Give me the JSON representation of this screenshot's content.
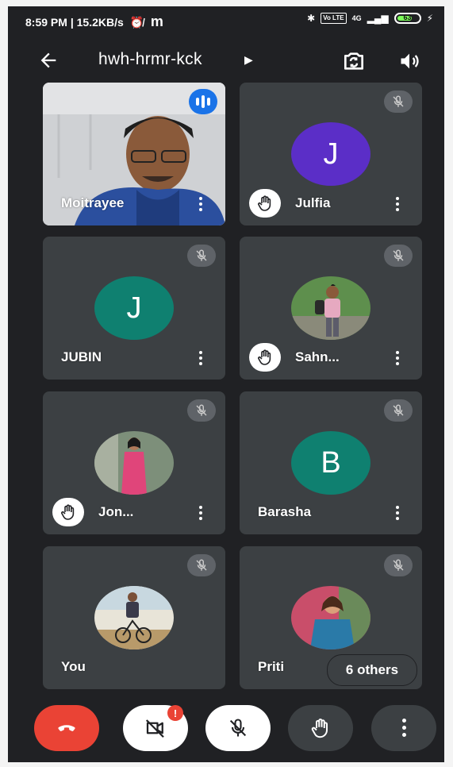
{
  "status_bar": {
    "time": "8:59 PM",
    "speed": "15.2KB/s",
    "network": "4G",
    "volte": "Vo LTE",
    "battery": "63"
  },
  "meeting": {
    "code": "hwh-hrmr-kck"
  },
  "participants": [
    {
      "name": "Moitrayee",
      "initial": "",
      "video": true,
      "speaking": true,
      "muted": false,
      "hand_raised": false
    },
    {
      "name": "Julfia",
      "initial": "J",
      "avatar_color": "#5b2ec7",
      "video": false,
      "muted": true,
      "hand_raised": true
    },
    {
      "name": "JUBIN",
      "initial": "J",
      "avatar_color": "#0f8070",
      "video": false,
      "muted": true,
      "hand_raised": false
    },
    {
      "name": "Sahn...",
      "initial": "",
      "photo": true,
      "muted": true,
      "hand_raised": true
    },
    {
      "name": "Jon...",
      "initial": "",
      "photo": true,
      "muted": true,
      "hand_raised": true
    },
    {
      "name": "Barasha",
      "initial": "B",
      "avatar_color": "#0f8070",
      "video": false,
      "muted": true,
      "hand_raised": false
    },
    {
      "name": "You",
      "initial": "",
      "photo": true,
      "muted": true,
      "hand_raised": false
    },
    {
      "name": "Priti",
      "initial": "",
      "photo": true,
      "muted": true,
      "hand_raised": false
    }
  ],
  "others_label": "6 others",
  "controls": {
    "camera_badge": "!"
  },
  "colors": {
    "background": "#202124",
    "tile": "#3c4043",
    "end_call": "#ea4335",
    "speaking": "#1a73e8"
  }
}
